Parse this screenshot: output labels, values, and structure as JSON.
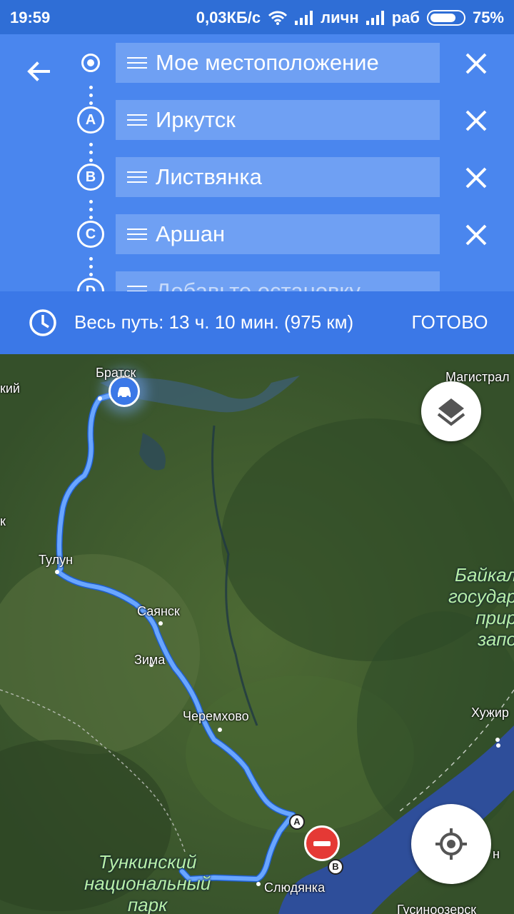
{
  "status_bar": {
    "time": "19:59",
    "speed": "0,03КБ/с",
    "sim1": "личн",
    "sim2": "раб",
    "battery": "75%"
  },
  "directions": {
    "stops": [
      {
        "marker": "",
        "label": "Мое местоположение",
        "placeholder": false
      },
      {
        "marker": "A",
        "label": "Иркутск",
        "placeholder": false
      },
      {
        "marker": "B",
        "label": "Листвянка",
        "placeholder": false
      },
      {
        "marker": "C",
        "label": "Аршан",
        "placeholder": false
      },
      {
        "marker": "D",
        "label": "Добавьте остановку",
        "placeholder": true
      }
    ]
  },
  "summary": {
    "text": "Весь путь: 13 ч. 10 мин.  (975 км)",
    "done_label": "ГОТОВО"
  },
  "map": {
    "labels": {
      "bratsk": "Братск",
      "kiy": "кий",
      "magistral": "Магистрал",
      "tulun": "Тулун",
      "sayansk": "Саянск",
      "zima": "Зима",
      "cheremkhovo": "Черемхово",
      "khuzhir": "Хужир",
      "slyudyanka": "Слюдянка",
      "gusinoozersk": "Гусиноозерск",
      "k": "к",
      "n": "н"
    },
    "park": [
      "Тункинский",
      "национальный",
      "парк"
    ],
    "preserve": [
      "Байкал",
      "государ",
      "прир",
      "запо"
    ],
    "pins": {
      "a": "A",
      "b": "B"
    },
    "colors": {
      "route": "#69a6ff",
      "water": "#2e4e9a",
      "header": "#4a86ee"
    }
  }
}
